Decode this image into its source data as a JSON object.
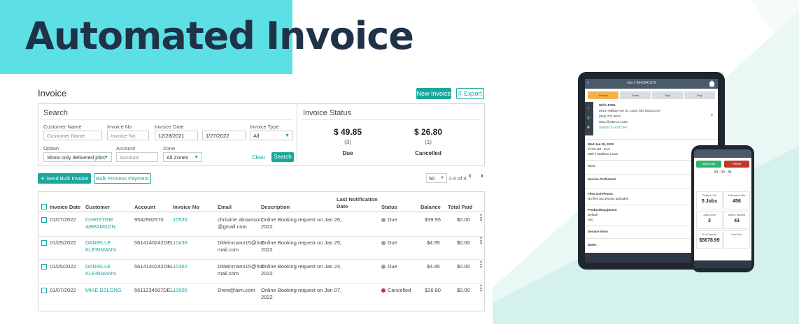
{
  "hero": {
    "word1": "Automated",
    "word2": "Invoice"
  },
  "invoice": {
    "title": "Invoice",
    "new_invoice_label": "New Invoice",
    "export_label": "Export",
    "search": {
      "title": "Search",
      "customer_name_label": "Customer Name",
      "customer_name_placeholder": "Customer Name",
      "invoice_no_label": "Invoice No",
      "invoice_no_placeholder": "Invoice No",
      "invoice_date_label": "Invoice Date",
      "date_from": "12/28/2021",
      "date_to": "1/27/2022",
      "invoice_type_label": "Invoice Type",
      "invoice_type_value": "All",
      "option_label": "Option",
      "option_value": "Show only delivered jobs",
      "account_label": "Account",
      "account_placeholder": "Account",
      "zone_label": "Zone",
      "zone_value": "All Zones",
      "clear_label": "Clear",
      "search_label": "Search"
    },
    "status": {
      "title": "Invoice Status",
      "due_amount": "$ 49.85",
      "due_count": "(3)",
      "due_label": "Due",
      "cancelled_amount": "$ 26.80",
      "cancelled_count": "(1)",
      "cancelled_label": "Cancelled"
    },
    "send_bulk_label": "Send Bulk Invoice",
    "bulk_payment_label": "Bulk Process Payment",
    "page_size": "50",
    "page_range": "1-4 of 4",
    "columns": {
      "invoice_date": "Invoice Date",
      "customer": "Customer",
      "account": "Account",
      "invoice_no": "Invoice No",
      "email": "Email",
      "description": "Description",
      "last_notification_1": "Last Notification",
      "last_notification_2": "Date",
      "status": "Status",
      "balance": "Balance",
      "total_paid": "Total Paid"
    },
    "rows": [
      {
        "date": "01/27/2022",
        "customer1": "CHRISTINE",
        "customer2": "ABRAMSON",
        "account": "9542902570",
        "invoice_no": "10535",
        "email1": "christine abramson",
        "email2": "@gmail.com",
        "desc1": "Online Booking request on Jan 26,",
        "desc2": "2022",
        "status": "Due",
        "balance": "$39.95",
        "paid": "$0.00"
      },
      {
        "date": "01/25/2022",
        "customer1": "DANIELLE",
        "customer2": "KLEINMANN",
        "account": "5614140242DEL",
        "invoice_no": "10436",
        "email1": "Dkleinmann15@hot",
        "email2": "mail.com",
        "desc1": "Online Booking request on Jan 25,",
        "desc2": "2022",
        "status": "Due",
        "balance": "$4.95",
        "paid": "$0.00"
      },
      {
        "date": "01/25/2022",
        "customer1": "DANIELLE",
        "customer2": "KLEINMANN",
        "account": "5614140242DEL",
        "invoice_no": "10362",
        "email1": "Dkleinmann15@hot",
        "email2": "mail.com",
        "desc1": "Online Booking request on Jan 24,",
        "desc2": "2022",
        "status": "Due",
        "balance": "$4.95",
        "paid": "$0.00"
      },
      {
        "date": "01/07/2022",
        "customer1": "MIKE DZLONG",
        "customer2": "",
        "account": "5611234567DEL",
        "invoice_no": "10005",
        "email1": "Drew@aim.com",
        "email2": "",
        "desc1": "Online Booking request on Jan 07,",
        "desc2": "2022",
        "status": "Cancelled",
        "balance": "$26.80",
        "paid": "$0.00"
      }
    ],
    "colors": {
      "accent": "#19a79e",
      "due": "#9e9e9e",
      "cancelled": "#c0392b"
    }
  },
  "tablet": {
    "title": "Job # 0943941879",
    "tabs": [
      "Arrivals",
      "Email",
      "Sign",
      "Pay"
    ],
    "customer": "Will's FION",
    "address": "3514 Holliday Ave St. Louis, MO 63110,USA",
    "phone": "(304) 737-3973",
    "email": "WILL@GMAIL.COM",
    "service_history": "SERVICE HISTORY",
    "date": "Wed Jan 08, 2020",
    "time": "07:00 AM - 8Am",
    "tech": "SB/F | Matthew Lewis",
    "section_new": "NEW",
    "section_service": "Service Performed",
    "section_files": "Files and Photos",
    "files_note": "No files and photos uploaded",
    "section_product": "Product/Equipment",
    "product_1": "Default",
    "product_2": "Abc",
    "section_items": "Service Items",
    "section_notes": "Notes"
  },
  "phone": {
    "start_label": "Start Day",
    "pause_label": "Pause",
    "timer": "00 : 00 : 36",
    "today_label": "Today's Job",
    "today_value": "5 Jobs",
    "miles_label": "Estimated Mile",
    "miles_value": "456",
    "done_label": "Jobs Done",
    "done_value": "3",
    "traveled_label": "Miles Traveled",
    "traveled_value": "43",
    "deposit_label": "$ to Deposit",
    "deposit_value": "$5678.99",
    "next_label": "Next Job"
  }
}
